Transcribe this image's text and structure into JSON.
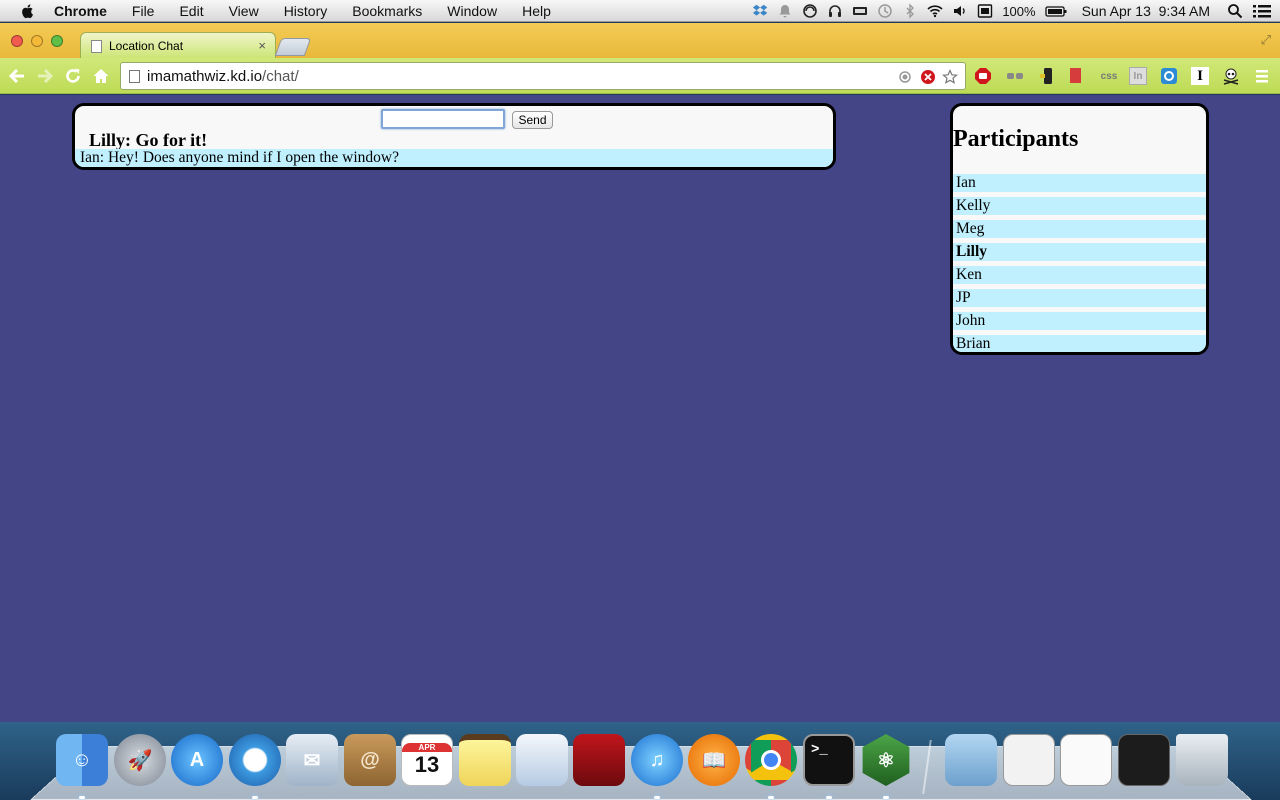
{
  "menubar": {
    "apple_icon": "apple-logo-icon",
    "items": [
      "Chrome",
      "File",
      "Edit",
      "View",
      "History",
      "Bookmarks",
      "Window",
      "Help"
    ],
    "battery": "100%",
    "datetime": "Sun Apr 13  9:34 AM"
  },
  "browser": {
    "tab_title": "Location Chat",
    "tab_close": "×",
    "url_host": "imamathwiz.kd.io",
    "url_path": "/chat/",
    "extensions": {
      "css": "css",
      "in": "In",
      "i": "I"
    }
  },
  "chat": {
    "input_value": "",
    "send_label": "Send",
    "status": "Lilly: Go for it!",
    "messages": [
      "Ian: Hey! Does anyone mind if I open the window?"
    ]
  },
  "participants": {
    "title": "Participants",
    "names": [
      "Ian",
      "Kelly",
      "Meg",
      "Lilly",
      "Ken",
      "JP",
      "John",
      "Brian"
    ],
    "current_user": "Lilly"
  },
  "dock": {
    "calendar_month": "APR",
    "calendar_day": "13",
    "apps": [
      "finder-icon",
      "launchpad-icon",
      "app-store-icon",
      "safari-icon",
      "mail-icon",
      "contacts-icon",
      "calendar-icon",
      "notes-icon",
      "preview-icon",
      "photo-booth-icon",
      "itunes-icon",
      "ibooks-icon",
      "chrome-icon",
      "terminal-icon",
      "atom-icon",
      "folder-icon",
      "chrome-window-icon",
      "finder-window-icon",
      "chrome-window-icon-2",
      "trash-icon"
    ]
  },
  "colors": {
    "page_background": "#434586",
    "message_row": "#c0f0fe",
    "panel_background": "#f8f8f8",
    "toolbar_green": "#c8e267",
    "tab_strip_yellow": "#f0c84c"
  }
}
